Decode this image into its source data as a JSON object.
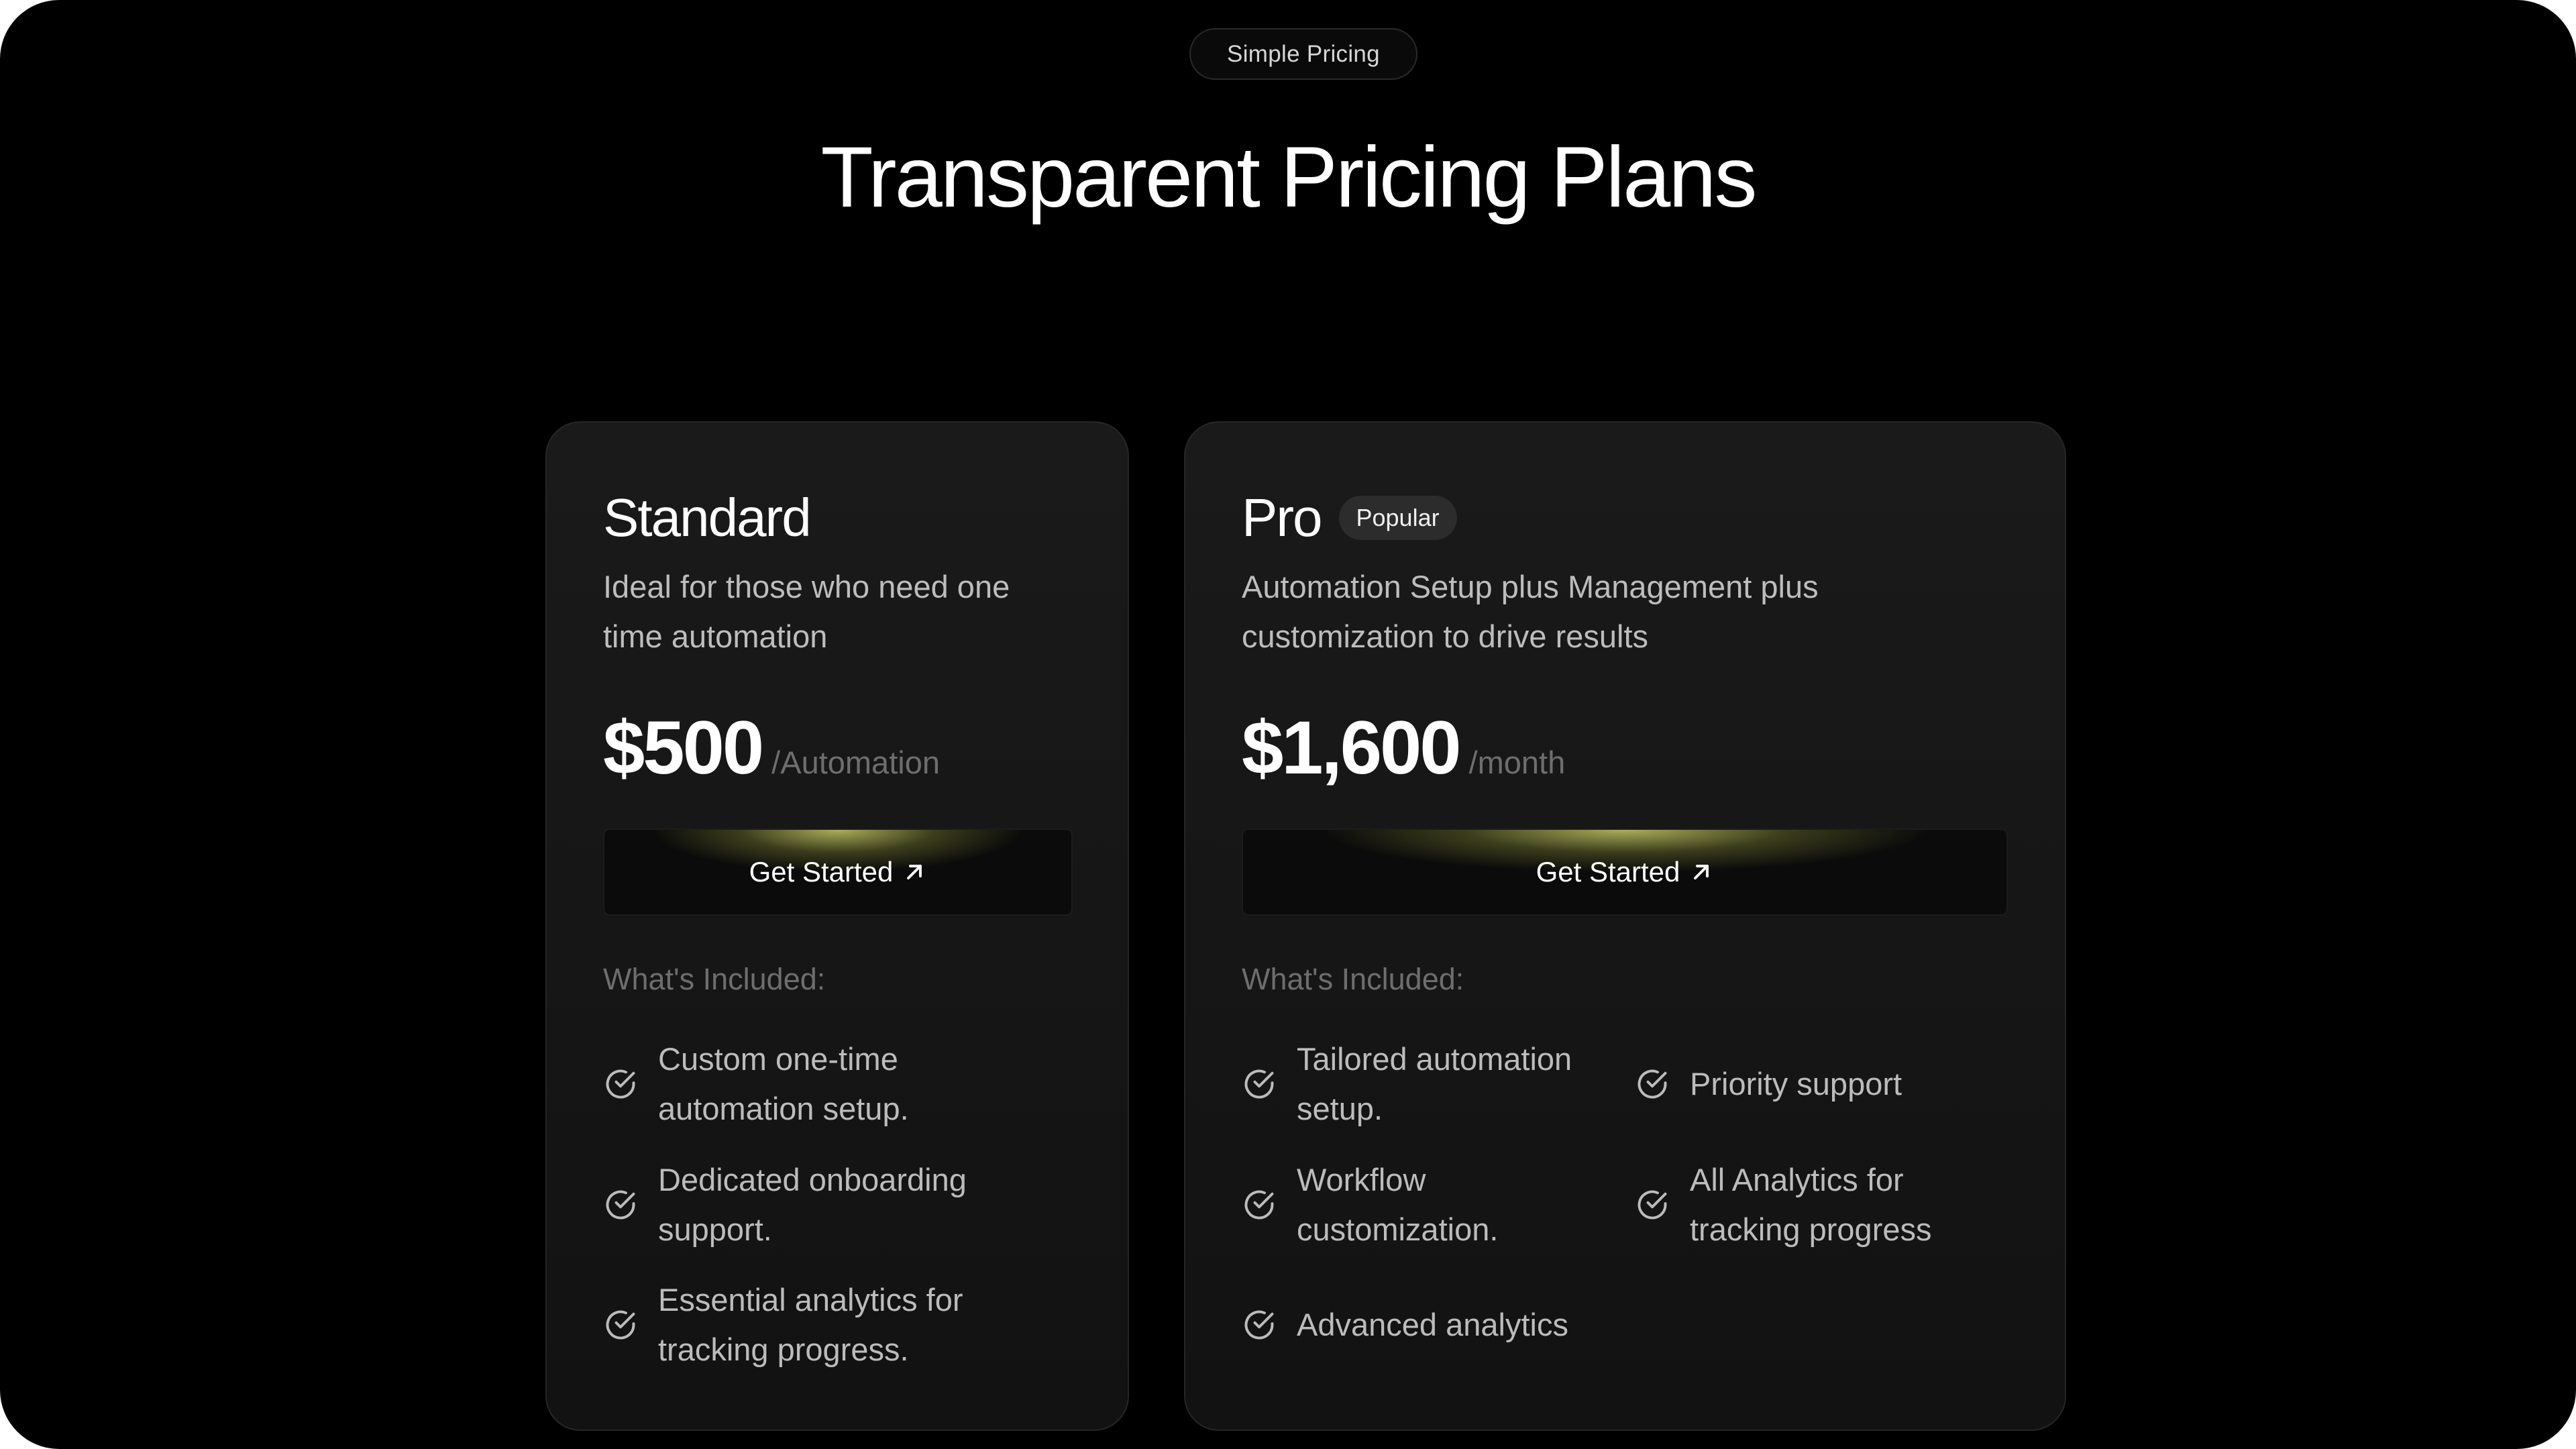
{
  "header": {
    "badge": "Simple Pricing",
    "title": "Transparent Pricing Plans"
  },
  "colors": {
    "background": "#000000",
    "card": "#161616",
    "cta_glow": "#d8dc6e",
    "text_primary": "#ffffff",
    "text_muted": "#6e6e6e"
  },
  "plans": [
    {
      "name": "Standard",
      "description": "Ideal for those who need one time automation",
      "price": "$500",
      "period": "/Automation",
      "cta_label": "Get Started",
      "cta_icon": "arrow-up-right-icon",
      "included_label": "What's Included:",
      "features": [
        "Custom one-time automation setup.",
        "Dedicated onboarding support.",
        "Essential analytics for tracking progress."
      ]
    },
    {
      "name": "Pro",
      "badge": "Popular",
      "description": "Automation Setup plus Management plus customization to drive results",
      "price": "$1,600",
      "period": "/month",
      "cta_label": "Get Started",
      "cta_icon": "arrow-up-right-icon",
      "included_label": "What's Included:",
      "features": [
        "Tailored automation setup.",
        "Priority support",
        "Workflow customization.",
        "All Analytics for tracking progress",
        "Advanced analytics"
      ]
    }
  ]
}
